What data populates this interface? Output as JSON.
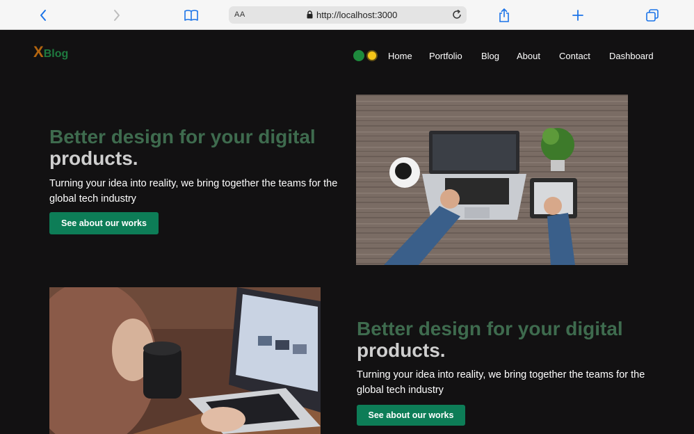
{
  "browser": {
    "text_size_label": "AA",
    "url": "http://localhost:3000"
  },
  "logo": {
    "x": "X",
    "text": "Blog"
  },
  "nav": {
    "items": [
      "Home",
      "Portfolio",
      "Blog",
      "About",
      "Contact",
      "Dashboard"
    ]
  },
  "sections": [
    {
      "title_highlight": "Better design for your digital",
      "title_rest": "products.",
      "text": "Turning your idea into reality, we bring together the teams for the global tech industry",
      "button": "See about our works"
    },
    {
      "title_highlight": "Better design for your digital",
      "title_rest": "products.",
      "text": "Turning your idea into reality, we bring together the teams for the global tech industry",
      "button": "See about our works"
    }
  ],
  "colors": {
    "page_bg": "#121112",
    "accent_green": "#3e6b4e",
    "button_green": "#0d7d57",
    "logo_orange": "#b3650f",
    "logo_green": "#1e7a3f"
  }
}
